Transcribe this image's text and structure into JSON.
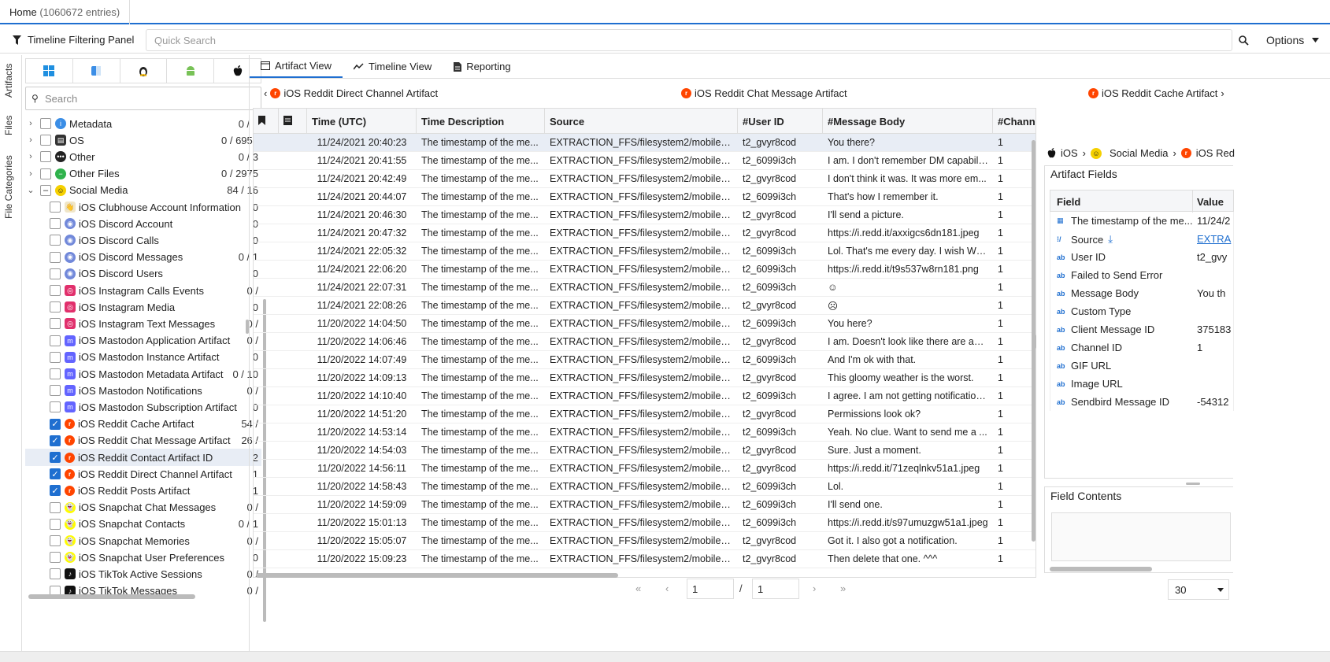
{
  "top": {
    "home_label": "Home",
    "entries": "(1060672 entries)"
  },
  "filter": {
    "panel_label": "Timeline Filtering Panel",
    "search_placeholder": "Quick Search",
    "options_label": "Options"
  },
  "vtabs": [
    "Artifacts",
    "Files",
    "File Categories"
  ],
  "left": {
    "os_icons": [
      "windows-icon",
      "mac-finder-icon",
      "linux-icon",
      "android-icon",
      "apple-icon"
    ],
    "search_placeholder": "Search",
    "tree": [
      {
        "label": "Metadata",
        "count": "0 / 2",
        "caret": "›",
        "icon": "info",
        "check": ""
      },
      {
        "label": "OS",
        "count": "0 / 6951",
        "caret": "›",
        "icon": "os",
        "check": ""
      },
      {
        "label": "Other",
        "count": "0 / 3",
        "caret": "›",
        "icon": "other",
        "check": ""
      },
      {
        "label": "Other Files",
        "count": "0 / 2975",
        "caret": "›",
        "icon": "otherfiles",
        "check": ""
      },
      {
        "label": "Social Media",
        "count": "84 / 16",
        "caret": "⌄",
        "icon": "social",
        "check": "–"
      },
      {
        "label": "iOS Clubhouse Account Information",
        "count": "0",
        "icon": "clubhouse",
        "check": ""
      },
      {
        "label": "iOS Discord Account",
        "count": "0",
        "icon": "discord",
        "check": ""
      },
      {
        "label": "iOS Discord Calls",
        "count": "0",
        "icon": "discord",
        "check": ""
      },
      {
        "label": "iOS Discord Messages",
        "count": "0 / 1",
        "icon": "discord",
        "check": ""
      },
      {
        "label": "iOS Discord Users",
        "count": "0",
        "icon": "discord",
        "check": ""
      },
      {
        "label": "iOS Instagram Calls Events",
        "count": "0 /",
        "icon": "instagram",
        "check": ""
      },
      {
        "label": "iOS Instagram Media",
        "count": "0",
        "icon": "instagram",
        "check": ""
      },
      {
        "label": "iOS Instagram Text Messages",
        "count": "0 /",
        "icon": "instagram",
        "check": ""
      },
      {
        "label": "iOS Mastodon Application Artifact",
        "count": "0 /",
        "icon": "mastodon",
        "check": ""
      },
      {
        "label": "iOS Mastodon Instance Artifact",
        "count": "0",
        "icon": "mastodon",
        "check": ""
      },
      {
        "label": "iOS Mastodon Metadata Artifact",
        "count": "0 / 10",
        "icon": "mastodon",
        "check": ""
      },
      {
        "label": "iOS Mastodon Notifications",
        "count": "0 /",
        "icon": "mastodon",
        "check": ""
      },
      {
        "label": "iOS Mastodon Subscription Artifact",
        "count": "0",
        "icon": "mastodon",
        "check": ""
      },
      {
        "label": "iOS Reddit Cache Artifact",
        "count": "54 /",
        "icon": "reddit",
        "check": "✓"
      },
      {
        "label": "iOS Reddit Chat Message Artifact",
        "count": "26 /",
        "icon": "reddit",
        "check": "✓"
      },
      {
        "label": "iOS Reddit Contact Artifact ID",
        "count": "2",
        "icon": "reddit",
        "check": "✓",
        "selected": true
      },
      {
        "label": "iOS Reddit Direct Channel Artifact",
        "count": "1",
        "icon": "reddit",
        "check": "✓"
      },
      {
        "label": "iOS Reddit Posts Artifact",
        "count": "1",
        "icon": "reddit",
        "check": "✓"
      },
      {
        "label": "iOS Snapchat Chat Messages",
        "count": "0 /",
        "icon": "snapchat",
        "check": ""
      },
      {
        "label": "iOS Snapchat Contacts",
        "count": "0 / 1",
        "icon": "snapchat",
        "check": ""
      },
      {
        "label": "iOS Snapchat Memories",
        "count": "0 /",
        "icon": "snapchat",
        "check": ""
      },
      {
        "label": "iOS Snapchat User Preferences",
        "count": "0",
        "icon": "snapchat",
        "check": ""
      },
      {
        "label": "iOS TikTok Active Sessions",
        "count": "0 /",
        "icon": "tiktok",
        "check": ""
      },
      {
        "label": "iOS TikTok Messages",
        "count": "0 /",
        "icon": "tiktok",
        "check": ""
      }
    ]
  },
  "main": {
    "tabs": [
      "Artifact View",
      "Timeline View",
      "Reporting"
    ],
    "nav": {
      "prev": "iOS Reddit Direct Channel Artifact",
      "current": "iOS Reddit Chat Message Artifact",
      "next": "iOS Reddit Cache Artifact"
    },
    "columns": [
      "Time (UTC)",
      "Time Description",
      "Source",
      "#User ID",
      "#Message Body",
      "#Chann"
    ],
    "rows": [
      [
        "11/24/2021 20:40:23",
        "The timestamp of the me...",
        "EXTRACTION_FFS/filesystem2/mobile/C...",
        "t2_gvyr8cod",
        "You there?",
        "1"
      ],
      [
        "11/24/2021 20:41:55",
        "The timestamp of the me...",
        "EXTRACTION_FFS/filesystem2/mobile/C...",
        "t2_6099i3ch",
        "I am. I don't remember DM capabilit...",
        "1"
      ],
      [
        "11/24/2021 20:42:49",
        "The timestamp of the me...",
        "EXTRACTION_FFS/filesystem2/mobile/C...",
        "t2_gvyr8cod",
        "I don't think it was. It was more em...",
        "1"
      ],
      [
        "11/24/2021 20:44:07",
        "The timestamp of the me...",
        "EXTRACTION_FFS/filesystem2/mobile/C...",
        "t2_6099i3ch",
        "That's how I remember it.",
        "1"
      ],
      [
        "11/24/2021 20:46:30",
        "The timestamp of the me...",
        "EXTRACTION_FFS/filesystem2/mobile/C...",
        "t2_gvyr8cod",
        "I'll send a picture.",
        "1"
      ],
      [
        "11/24/2021 20:47:32",
        "The timestamp of the me...",
        "EXTRACTION_FFS/filesystem2/mobile/C...",
        "t2_gvyr8cod",
        "https://i.redd.it/axxigcs6dn181.jpeg",
        "1"
      ],
      [
        "11/24/2021 22:05:32",
        "The timestamp of the me...",
        "EXTRACTION_FFS/filesystem2/mobile/C...",
        "t2_6099i3ch",
        "Lol. That's me every day. I wish Win...",
        "1"
      ],
      [
        "11/24/2021 22:06:20",
        "The timestamp of the me...",
        "EXTRACTION_FFS/filesystem2/mobile/C...",
        "t2_6099i3ch",
        "https://i.redd.it/t9s537w8rn181.png",
        "1"
      ],
      [
        "11/24/2021 22:07:31",
        "The timestamp of the me...",
        "EXTRACTION_FFS/filesystem2/mobile/C...",
        "t2_6099i3ch",
        "☺",
        "1"
      ],
      [
        "11/24/2021 22:08:26",
        "The timestamp of the me...",
        "EXTRACTION_FFS/filesystem2/mobile/C...",
        "t2_gvyr8cod",
        "☹",
        "1"
      ],
      [
        "11/20/2022 14:04:50",
        "The timestamp of the me...",
        "EXTRACTION_FFS/filesystem2/mobile/C...",
        "t2_6099i3ch",
        "You here?",
        "1"
      ],
      [
        "11/20/2022 14:06:46",
        "The timestamp of the me...",
        "EXTRACTION_FFS/filesystem2/mobile/C...",
        "t2_gvyr8cod",
        "I am. Doesn't look like there are any...",
        "1"
      ],
      [
        "11/20/2022 14:07:49",
        "The timestamp of the me...",
        "EXTRACTION_FFS/filesystem2/mobile/C...",
        "t2_6099i3ch",
        "And I'm ok with that.",
        "1"
      ],
      [
        "11/20/2022 14:09:13",
        "The timestamp of the me...",
        "EXTRACTION_FFS/filesystem2/mobile/C...",
        "t2_gvyr8cod",
        "This gloomy weather is the worst.",
        "1"
      ],
      [
        "11/20/2022 14:10:40",
        "The timestamp of the me...",
        "EXTRACTION_FFS/filesystem2/mobile/C...",
        "t2_6099i3ch",
        "I agree. I am not getting notification...",
        "1"
      ],
      [
        "11/20/2022 14:51:20",
        "The timestamp of the me...",
        "EXTRACTION_FFS/filesystem2/mobile/C...",
        "t2_gvyr8cod",
        "Permissions look ok?",
        "1"
      ],
      [
        "11/20/2022 14:53:14",
        "The timestamp of the me...",
        "EXTRACTION_FFS/filesystem2/mobile/C...",
        "t2_6099i3ch",
        "Yeah.  No clue. Want to send me a ...",
        "1"
      ],
      [
        "11/20/2022 14:54:03",
        "The timestamp of the me...",
        "EXTRACTION_FFS/filesystem2/mobile/C...",
        "t2_gvyr8cod",
        "Sure. Just a moment.",
        "1"
      ],
      [
        "11/20/2022 14:56:11",
        "The timestamp of the me...",
        "EXTRACTION_FFS/filesystem2/mobile/C...",
        "t2_gvyr8cod",
        "https://i.redd.it/71zeqlnkv51a1.jpeg",
        "1"
      ],
      [
        "11/20/2022 14:58:43",
        "The timestamp of the me...",
        "EXTRACTION_FFS/filesystem2/mobile/C...",
        "t2_6099i3ch",
        "Lol.",
        "1"
      ],
      [
        "11/20/2022 14:59:09",
        "The timestamp of the me...",
        "EXTRACTION_FFS/filesystem2/mobile/C...",
        "t2_6099i3ch",
        "I'll send one.",
        "1"
      ],
      [
        "11/20/2022 15:01:13",
        "The timestamp of the me...",
        "EXTRACTION_FFS/filesystem2/mobile/C...",
        "t2_6099i3ch",
        "https://i.redd.it/s97umuzgw51a1.jpeg",
        "1"
      ],
      [
        "11/20/2022 15:05:07",
        "The timestamp of the me...",
        "EXTRACTION_FFS/filesystem2/mobile/C...",
        "t2_gvyr8cod",
        "Got it. I also got a notification.",
        "1"
      ],
      [
        "11/20/2022 15:09:23",
        "The timestamp of the me...",
        "EXTRACTION_FFS/filesystem2/mobile/C...",
        "t2_gvyr8cod",
        "Then delete that one. ^^^",
        "1"
      ]
    ],
    "pager": {
      "first": "«",
      "prev": "‹",
      "page": "1",
      "sep": "/",
      "total": "1",
      "next": "›",
      "last": "»",
      "page_size": "30"
    }
  },
  "right": {
    "breadcrumb": [
      "iOS",
      "Social Media",
      "iOS Red"
    ],
    "artifact_fields_title": "Artifact Fields",
    "field_header": "Field",
    "value_header": "Value",
    "fields": [
      {
        "icon": "calendar",
        "name": "The timestamp of the me...",
        "value": "11/24/2"
      },
      {
        "icon": "source",
        "name": "Source",
        "value": "EXTRA",
        "link": true
      },
      {
        "icon": "ab",
        "name": "User ID",
        "value": "t2_gvy"
      },
      {
        "icon": "ab",
        "name": "Failed to Send Error",
        "value": ""
      },
      {
        "icon": "ab",
        "name": "Message Body",
        "value": "You th"
      },
      {
        "icon": "ab",
        "name": "Custom Type",
        "value": ""
      },
      {
        "icon": "ab",
        "name": "Client Message ID",
        "value": "375183"
      },
      {
        "icon": "ab",
        "name": "Channel ID",
        "value": "1"
      },
      {
        "icon": "ab",
        "name": "GIF URL",
        "value": ""
      },
      {
        "icon": "ab",
        "name": "Image URL",
        "value": ""
      },
      {
        "icon": "ab",
        "name": "Sendbird Message ID",
        "value": "-54312"
      }
    ],
    "field_contents_title": "Field Contents"
  },
  "colors": {
    "accent": "#1f6fd0",
    "reddit": "#ff4500",
    "selected_row": "#e8edf5"
  }
}
